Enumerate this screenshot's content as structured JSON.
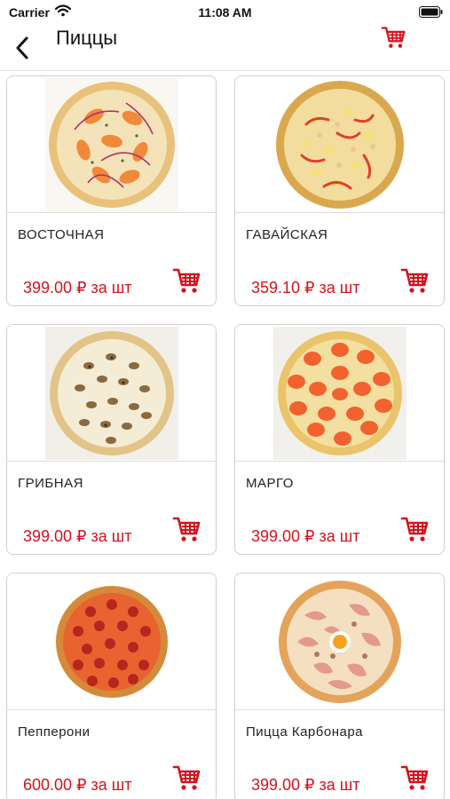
{
  "status_bar": {
    "carrier": "Carrier",
    "time": "11:08 AM"
  },
  "header": {
    "title": "Пиццы"
  },
  "colors": {
    "accent": "#d5121c",
    "border": "#cfcfcf"
  },
  "products": [
    {
      "name": "ВОСТОЧНАЯ",
      "price": "399.00 ₽  за шт",
      "image": "pizza-vostochnaya"
    },
    {
      "name": "ГАВАЙСКАЯ",
      "price": "359.10 ₽  за шт",
      "image": "pizza-gavayskaya"
    },
    {
      "name": "ГРИБНАЯ",
      "price": "399.00 ₽  за шт",
      "image": "pizza-gribnaya"
    },
    {
      "name": "МАРГО",
      "price": "399.00 ₽  за шт",
      "image": "pizza-margo"
    },
    {
      "name": "Пепперони",
      "price": "600.00 ₽  за шт",
      "image": "pizza-pepperoni"
    },
    {
      "name": "Пицца Карбонара",
      "price": "399.00 ₽  за шт",
      "image": "pizza-karbonara"
    }
  ]
}
